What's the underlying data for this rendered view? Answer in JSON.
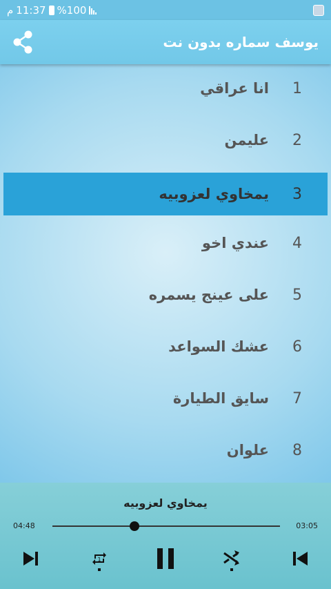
{
  "status": {
    "time": "11:37",
    "battery": "%100",
    "carrier_mark": "م"
  },
  "header": {
    "title": "يوسف سماره بدون نت",
    "share_icon": "share-icon"
  },
  "tracks": [
    {
      "num": "1",
      "title": "انا عراقي"
    },
    {
      "num": "2",
      "title": "عليمن"
    },
    {
      "num": "3",
      "title": "يمخاوي لعزوبيه"
    },
    {
      "num": "4",
      "title": "عندي اخو"
    },
    {
      "num": "5",
      "title": "على عينج يسمره"
    },
    {
      "num": "6",
      "title": "عشك السواعد"
    },
    {
      "num": "7",
      "title": "سايق الطيارة"
    },
    {
      "num": "8",
      "title": "علوان"
    }
  ],
  "active_track_index": 2,
  "player": {
    "now_playing": "يمخاوي لعزوبيه",
    "elapsed": "04:48",
    "total": "03:05",
    "progress": 0.36,
    "icons": [
      "skip-next-icon",
      "repeat-one-icon",
      "pause-icon",
      "shuffle-icon",
      "skip-previous-icon"
    ]
  },
  "colors": {
    "header": "#72c8e8",
    "active_row": "#2aa2d8",
    "player_bg": "#79c9d3"
  }
}
